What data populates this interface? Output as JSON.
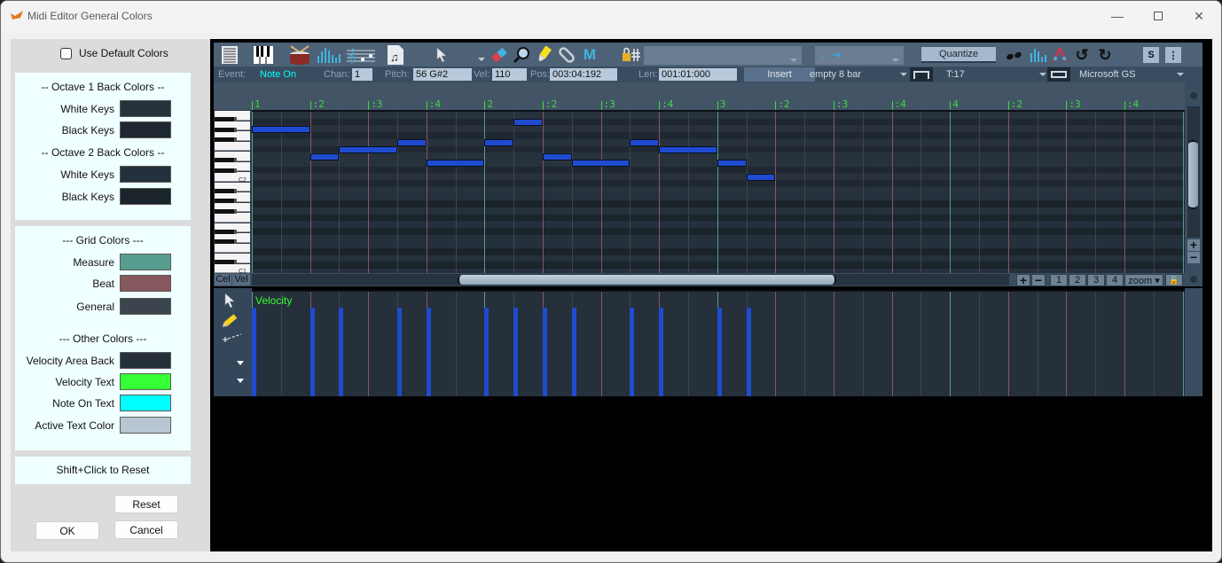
{
  "window": {
    "title": "Midi Editor General Colors",
    "controls": [
      "minimize",
      "maximize",
      "close"
    ]
  },
  "settings": {
    "use_default_label": "Use Default Colors",
    "use_default_checked": false,
    "octave1": {
      "heading": "--  Octave 1 Back Colors  --",
      "white_label": "White Keys",
      "white_color": "#27323d",
      "black_label": "Black Keys",
      "black_color": "#1f2832"
    },
    "octave2": {
      "heading": "--  Octave 2 Back Colors  --",
      "white_label": "White Keys",
      "white_color": "#24303b",
      "black_label": "Black Keys",
      "black_color": "#1b232b"
    },
    "grid": {
      "heading": "---  Grid Colors  ---",
      "measure_label": "Measure",
      "measure_color": "#579c8e",
      "beat_label": "Beat",
      "beat_color": "#87575e",
      "general_label": "General",
      "general_color": "#3c454d"
    },
    "other": {
      "heading": "---  Other Colors  ---",
      "vel_back_label": "Velocity Area Back",
      "vel_back_color": "#25303b",
      "vel_text_label": "Velocity Text",
      "vel_text_color": "#35ff35",
      "note_on_label": "Note On Text",
      "note_on_color": "#00ffff",
      "active_label": "Active Text Color",
      "active_color": "#b8c6d4"
    },
    "hint": "Shift+Click to Reset",
    "reset_label": "Reset",
    "ok_label": "OK",
    "cancel_label": "Cancel"
  },
  "toolbar": {
    "icons": [
      "event-list-icon",
      "piano-icon",
      "drum-icon",
      "velocity-icon",
      "score-icon",
      "sheet-icon",
      "pointer-icon",
      "eraser-icon",
      "zoom-tool-icon",
      "highlighter-icon",
      "clip-icon",
      "mute-m-icon",
      "snap-lock-icon"
    ],
    "mute_letter": "M",
    "combo1_value": "",
    "combo2_value": "",
    "quantize_label": "Quantize",
    "right_icons": [
      "legato-icon",
      "velocity-scale-icon",
      "humanize-icon",
      "undo-icon",
      "redo-icon"
    ],
    "s_label": "S",
    "more_label": "⋮"
  },
  "event_bar": {
    "event_label": "Event:",
    "event_value": "Note On",
    "chan_label": "Chan:",
    "chan_value": "1",
    "pitch_label": "Pitch:",
    "pitch_value": "56 G#2",
    "vel_label": "Vel:",
    "vel_value": "110",
    "pos_label": "Pos:",
    "pos_value": "003:04:192",
    "len_label": "Len:",
    "len_value": "001:01:000",
    "insert_label": "Insert",
    "template_value": "empty 8 bar",
    "track_value": "T:17",
    "device_value": "Microsoft GS"
  },
  "ruler": {
    "labels": [
      "1",
      ":2",
      ":3",
      ":4",
      "2",
      ":2",
      ":3",
      ":4",
      "3",
      ":2",
      ":3",
      ":4",
      "4",
      ":2",
      ":3",
      ":4"
    ]
  },
  "piano": {
    "c2_label": "C2",
    "c1_label": "C1"
  },
  "notes": [
    {
      "beat": 0,
      "len": 1,
      "row": 1
    },
    {
      "beat": 1,
      "len": 0.5,
      "row": 5
    },
    {
      "beat": 1.5,
      "len": 1,
      "row": 4
    },
    {
      "beat": 2.5,
      "len": 0.5,
      "row": 3
    },
    {
      "beat": 3,
      "len": 1,
      "row": 6
    },
    {
      "beat": 4,
      "len": 0.5,
      "row": 3
    },
    {
      "beat": 4.5,
      "len": 0.5,
      "row": 0
    },
    {
      "beat": 5,
      "len": 0.5,
      "row": 5
    },
    {
      "beat": 5.5,
      "len": 1,
      "row": 6
    },
    {
      "beat": 6.5,
      "len": 0.5,
      "row": 3
    },
    {
      "beat": 7,
      "len": 1,
      "row": 4
    },
    {
      "beat": 8,
      "len": 0.5,
      "row": 6
    },
    {
      "beat": 8.5,
      "len": 0.5,
      "row": 8
    }
  ],
  "split_tabs": {
    "cel": "Cel",
    "vel": "Vel"
  },
  "zoom_controls": {
    "plus": "+",
    "minus": "−",
    "z1": "1",
    "z2": "2",
    "z3": "3",
    "z4": "4",
    "zoom": "zoom ▾"
  },
  "velocity": {
    "label": "Velocity",
    "value_fraction": 0.85
  }
}
